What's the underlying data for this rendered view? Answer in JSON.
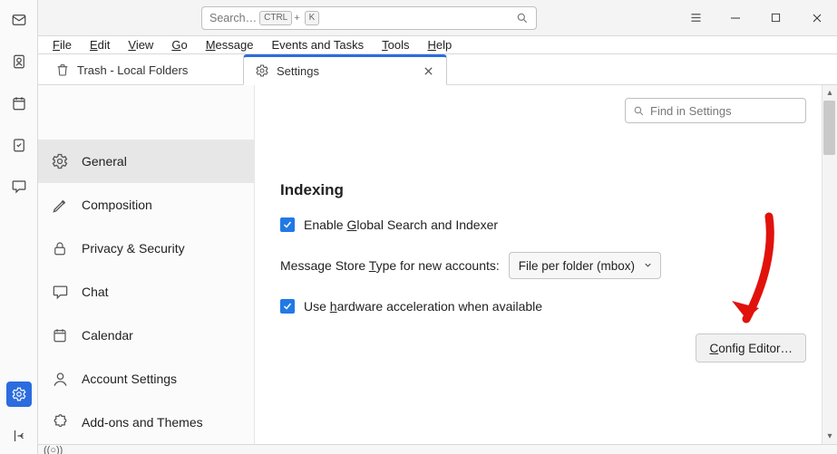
{
  "titlebar": {
    "search_placeholder": "Search…",
    "kbd_ctrl": "CTRL",
    "kbd_plus": "+",
    "kbd_k": "K"
  },
  "menu": {
    "file": "File",
    "edit": "Edit",
    "view": "View",
    "go": "Go",
    "message": "Message",
    "events": "Events and Tasks",
    "tools": "Tools",
    "help": "Help"
  },
  "tabs": {
    "trash": "Trash - Local Folders",
    "settings": "Settings"
  },
  "sidebar": {
    "general": "General",
    "composition": "Composition",
    "privacy": "Privacy & Security",
    "chat": "Chat",
    "calendar": "Calendar",
    "account": "Account Settings",
    "addons": "Add-ons and Themes"
  },
  "settings": {
    "find_placeholder": "Find in Settings",
    "section": "Indexing",
    "enable_global_pre": "Enable ",
    "enable_global_u": "G",
    "enable_global_post": "lobal Search and Indexer",
    "store_label_pre": "Message Store ",
    "store_label_u": "T",
    "store_label_post": "ype for new accounts:",
    "store_value": "File per folder (mbox)",
    "hw_pre": "Use ",
    "hw_u": "h",
    "hw_post": "ardware acceleration when available",
    "config_pre": "C",
    "config_post": "onfig Editor…"
  },
  "status": {
    "sync": "((○))"
  }
}
